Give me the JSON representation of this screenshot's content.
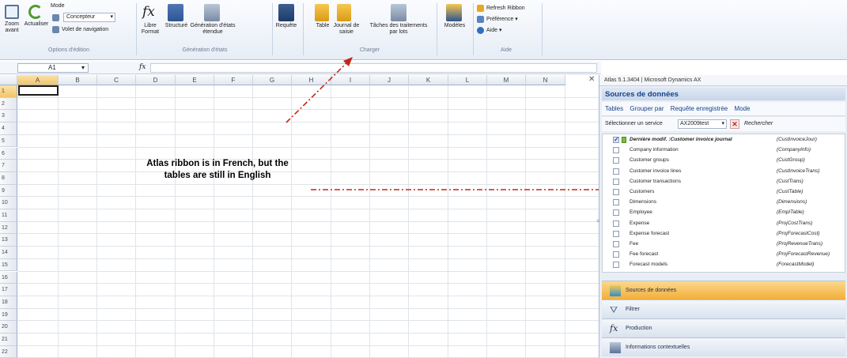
{
  "ribbon": {
    "zoom_label": "Zoom avant",
    "refresh_label": "Actualiser",
    "mode_label": "Mode",
    "mode_value": "Concepteur",
    "navpane_label": "Volet de navigation",
    "group_edit": "Options d'édition",
    "free_format_label": "Libre Format",
    "structure_label": "Structuré",
    "gen_label": "Génération d'états étendue",
    "group_reports": "Génération d'états",
    "query_label": "Requête",
    "table_label": "Table",
    "journal_label": "Journal de saisie",
    "tasks_label": "Tâches des traitements par lots",
    "group_load": "Charger",
    "models_label": "Modèles",
    "refresh_ribbon": "Refresh Ribbon",
    "preference": "Préférence",
    "help": "Aide",
    "group_help": "Aide"
  },
  "formula": {
    "namebox": "A1",
    "fx": "fx"
  },
  "grid": {
    "columns": [
      "A",
      "B",
      "C",
      "D",
      "E",
      "F",
      "G",
      "H",
      "I",
      "J",
      "K",
      "L",
      "M",
      "N"
    ],
    "rows": [
      "1",
      "2",
      "3",
      "4",
      "5",
      "6",
      "7",
      "8",
      "9",
      "10",
      "11",
      "12",
      "13",
      "14",
      "15",
      "16",
      "17",
      "18",
      "19",
      "20",
      "21",
      "22"
    ]
  },
  "annotation": "Atlas ribbon is in French, but the tables are still in English",
  "pane": {
    "title": "Atlas 5.1.3404 | Microsoft Dynamics AX",
    "close": "✕",
    "header": "Sources de données",
    "menu": [
      "Tables",
      "Grouper par",
      "Requête enregistrée",
      "Mode"
    ],
    "service_label": "Sélectionner un service",
    "service_value": "AX2009test",
    "search": "Rechercher",
    "tables": [
      {
        "name": "Dernière modif. :Customer invoice journal",
        "code": "(CustInvoiceJour)",
        "checked": true
      },
      {
        "name": "Company information",
        "code": "(CompanyInfo)",
        "checked": false
      },
      {
        "name": "Customer groups",
        "code": "(CustGroup)",
        "checked": false
      },
      {
        "name": "Customer invoice lines",
        "code": "(CustInvoiceTrans)",
        "checked": false
      },
      {
        "name": "Customer transactions",
        "code": "(CustTrans)",
        "checked": false
      },
      {
        "name": "Customers",
        "code": "(CustTable)",
        "checked": false
      },
      {
        "name": "Dimensions",
        "code": "(Dimensions)",
        "checked": false
      },
      {
        "name": "Employee",
        "code": "(EmplTable)",
        "checked": false
      },
      {
        "name": "Expense",
        "code": "(ProjCostTrans)",
        "checked": false
      },
      {
        "name": "Expense forecast",
        "code": "(ProjForecastCost)",
        "checked": false
      },
      {
        "name": "Fee",
        "code": "(ProjRevenueTrans)",
        "checked": false
      },
      {
        "name": "Fee forecast",
        "code": "(ProjForecastRevenue)",
        "checked": false
      },
      {
        "name": "Forecast models",
        "code": "(ForecastModel)",
        "checked": false
      }
    ],
    "nav": [
      "Sources de données",
      "Filtrer",
      "Production",
      "Informations contextuelles"
    ]
  },
  "colors": {
    "arrow": "#c0281c",
    "accent": "#15428b",
    "nav_active": "#f3ad3a"
  }
}
